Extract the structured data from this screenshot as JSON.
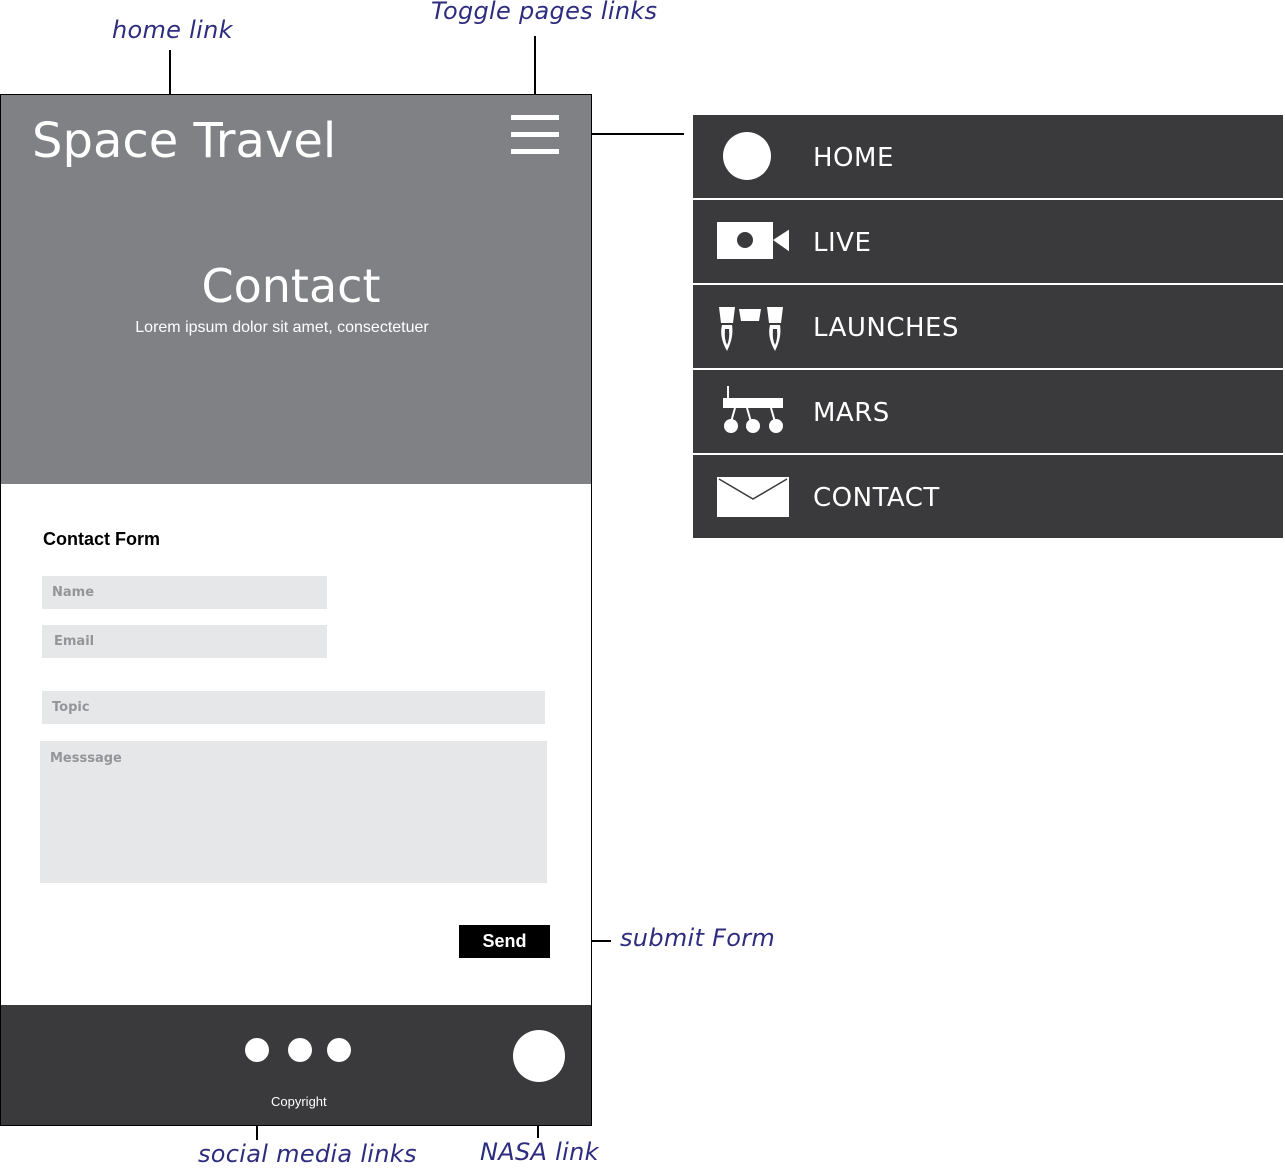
{
  "annotations": {
    "home_link": "home link",
    "toggle_pages_links": "Toggle pages links",
    "submit_form": "submit Form",
    "social_media_links": "social media links",
    "nasa_link": "NASA link"
  },
  "header": {
    "brand": "Space Travel",
    "menu_toggle_icon": "hamburger-icon"
  },
  "hero": {
    "title": "Contact",
    "subtitle": "Lorem ipsum dolor sit amet, consectetuer"
  },
  "form": {
    "title": "Contact Form",
    "name_placeholder": "Name",
    "email_placeholder": "Email",
    "topic_placeholder": "Topic",
    "message_placeholder": "Messsage",
    "send_label": "Send"
  },
  "footer": {
    "copyright": "Copyright",
    "social_icons": [
      "social-icon-1",
      "social-icon-2",
      "social-icon-3"
    ],
    "nasa_icon": "nasa-logo-icon"
  },
  "menu": {
    "items": [
      {
        "label": "HOME",
        "icon": "home-icon"
      },
      {
        "label": "LIVE",
        "icon": "video-camera-icon"
      },
      {
        "label": "LAUNCHES",
        "icon": "rockets-icon"
      },
      {
        "label": "MARS",
        "icon": "rover-icon"
      },
      {
        "label": "CONTACT",
        "icon": "envelope-icon"
      }
    ]
  },
  "colors": {
    "header_bg": "#808184",
    "dark_bg": "#3a3a3c",
    "input_bg": "#e6e7e8",
    "annotation": "#2e2c7e"
  }
}
